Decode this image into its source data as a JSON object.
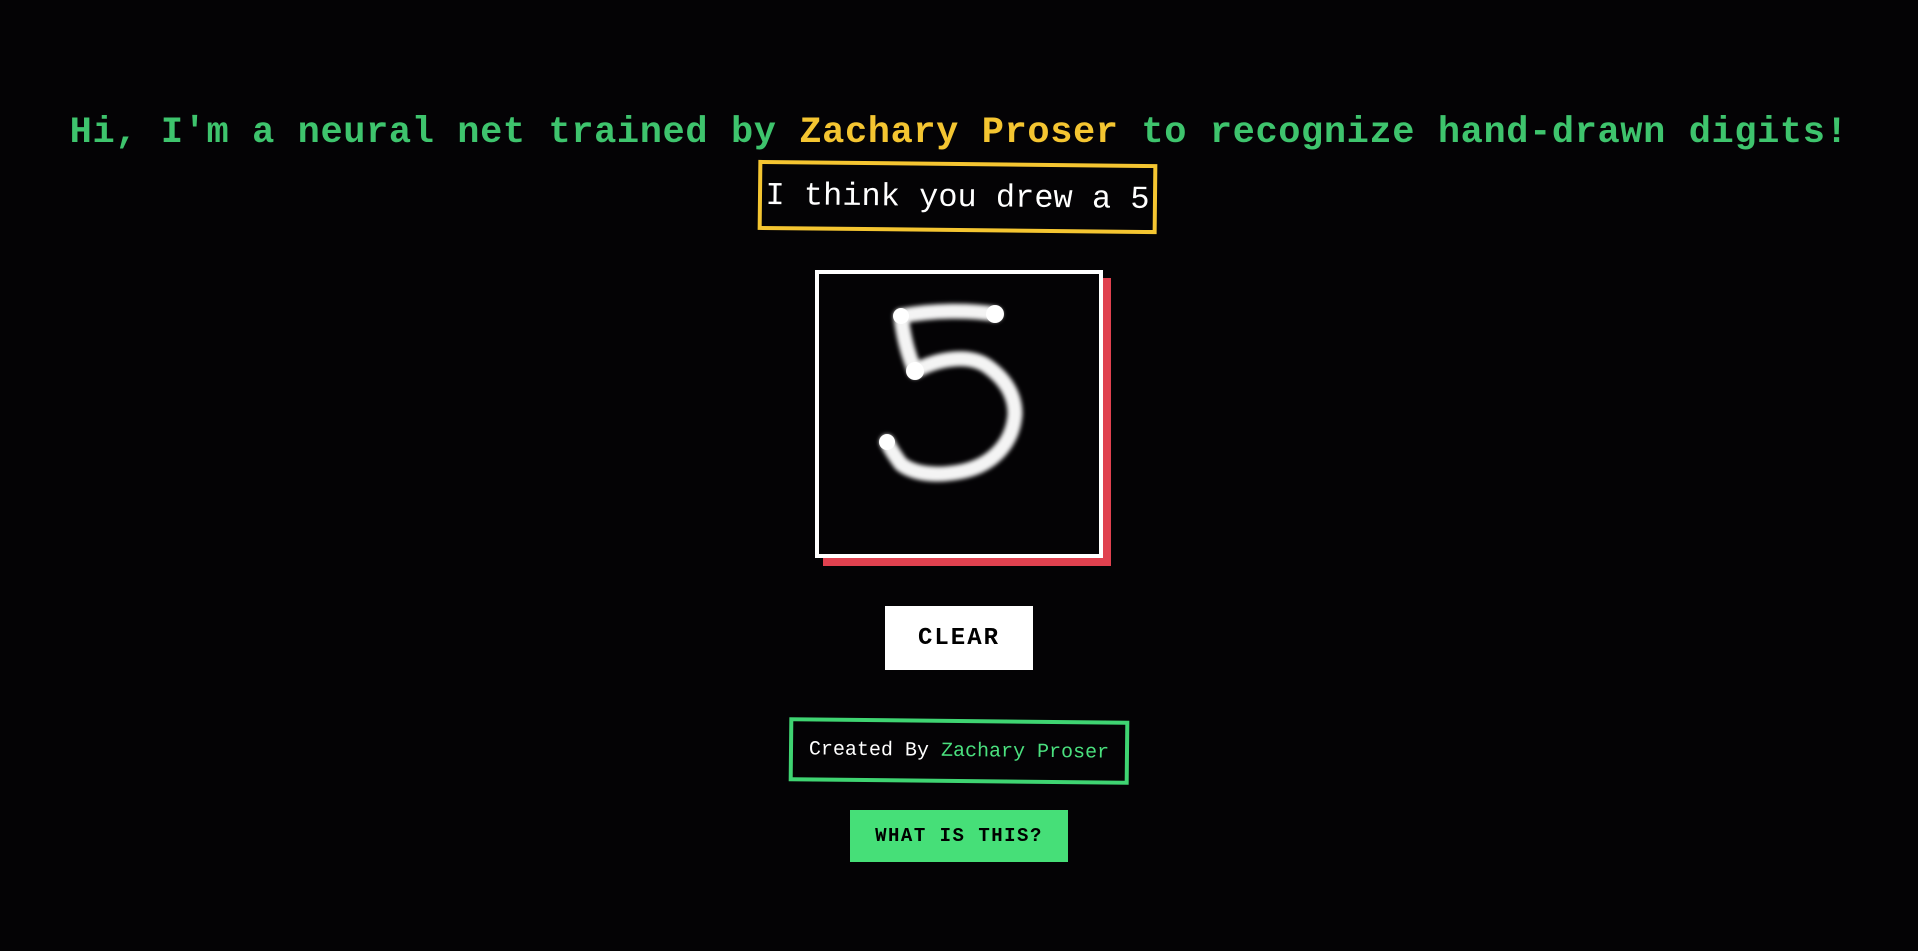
{
  "header": {
    "intro": "Hi, I'm a neural net trained by ",
    "author": "Zachary Proser",
    "outro": " to recognize hand-drawn digits!"
  },
  "prediction": {
    "text": "I think you drew a 5",
    "digit": 5
  },
  "drawing_canvas": {
    "drawn_digit": "5"
  },
  "controls": {
    "clear_label": "CLEAR",
    "what_label": "WHAT IS THIS?"
  },
  "credit": {
    "prefix": "Created By",
    "author": "Zachary Proser"
  },
  "colors": {
    "background": "#040305",
    "headline_green": "#3ec46d",
    "author_yellow": "#f4c531",
    "canvas_shadow_red": "#e0414f",
    "credit_green": "#3fd472",
    "button_green": "#46df78"
  }
}
